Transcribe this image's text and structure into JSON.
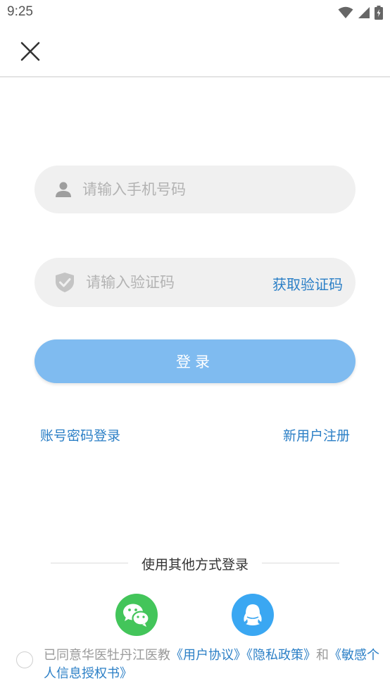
{
  "status_bar": {
    "time": "9:25"
  },
  "form": {
    "phone_placeholder": "请输入手机号码",
    "code_placeholder": "请输入验证码",
    "get_code_label": "获取验证码",
    "login_label": "登录"
  },
  "links": {
    "password_login": "账号密码登录",
    "register": "新用户注册"
  },
  "other_login": {
    "title": "使用其他方式登录"
  },
  "agreement": {
    "prefix": "已同意华医牡丹江医教",
    "user_agreement": "《用户协议》",
    "privacy_policy": "《隐私政策》",
    "and": "和",
    "personal_info": "《敏感个人信息授权书》"
  },
  "colors": {
    "accent": "#2b7fc6",
    "login_button": "#7fbbf0",
    "wechat": "#43c55a",
    "qq": "#3aa7f2"
  },
  "icons": [
    "close-icon",
    "user-icon",
    "shield-check-icon",
    "wechat-icon",
    "qq-icon",
    "wifi-icon",
    "signal-icon",
    "battery-icon"
  ]
}
